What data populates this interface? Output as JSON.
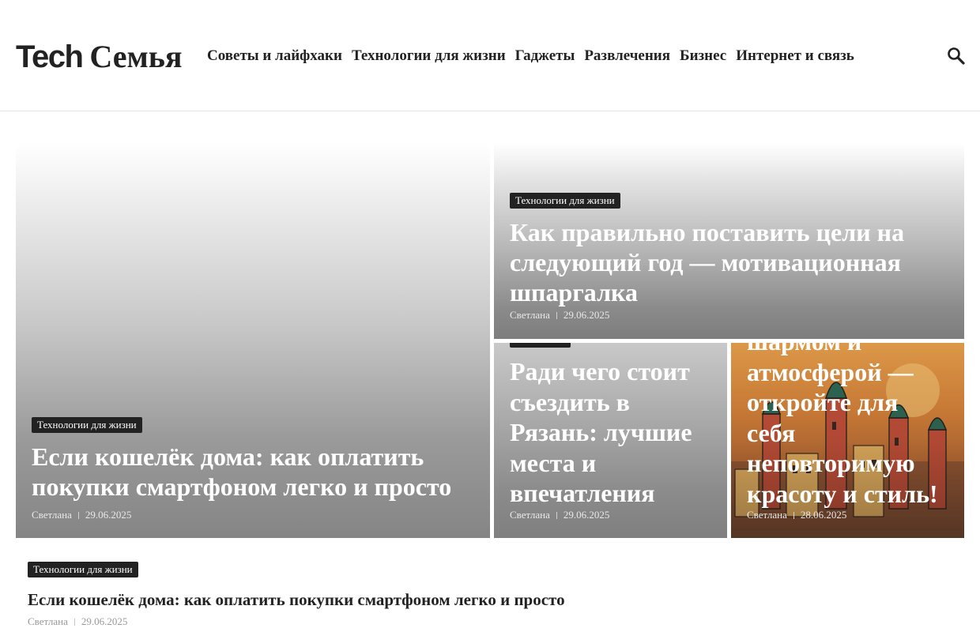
{
  "header": {
    "logo_tech": "Tech",
    "logo_family": "Семья",
    "nav": [
      {
        "label": "Советы и лайфхаки"
      },
      {
        "label": "Технологии для жизни"
      },
      {
        "label": "Гаджеты"
      },
      {
        "label": "Развлечения"
      },
      {
        "label": "Бизнес"
      },
      {
        "label": "Интернет и связь"
      }
    ],
    "search_icon": "search-icon"
  },
  "cards": [
    {
      "category": "Технологии для жизни",
      "title": "Если кошелёк дома: как оплатить покупки смартфоном легко и просто",
      "author": "Светлана",
      "date": "29.06.2025"
    },
    {
      "category": "Технологии для жизни",
      "title": "Как правильно поставить цели на следующий год — мотивационная шпаргалка",
      "author": "Светлана",
      "date": "29.06.2025"
    },
    {
      "category": "",
      "title": "Ради чего стоит съездить в Рязань: лучшие места и впечатления",
      "author": "Светлана",
      "date": "29.06.2025"
    },
    {
      "title": "шармом и атмосферой — откройте для себя неповторимую красоту и стиль!",
      "author": "Светлана",
      "date": "28.06.2025"
    }
  ],
  "list": [
    {
      "category": "Технологии для жизни",
      "title": "Если кошелёк дома: как оплатить покупки смартфоном легко и просто",
      "author": "Светлана",
      "date": "29.06.2025"
    }
  ],
  "colors": {
    "badge_bg": "#222222",
    "text": "#222222",
    "meta_gray": "#999999"
  }
}
